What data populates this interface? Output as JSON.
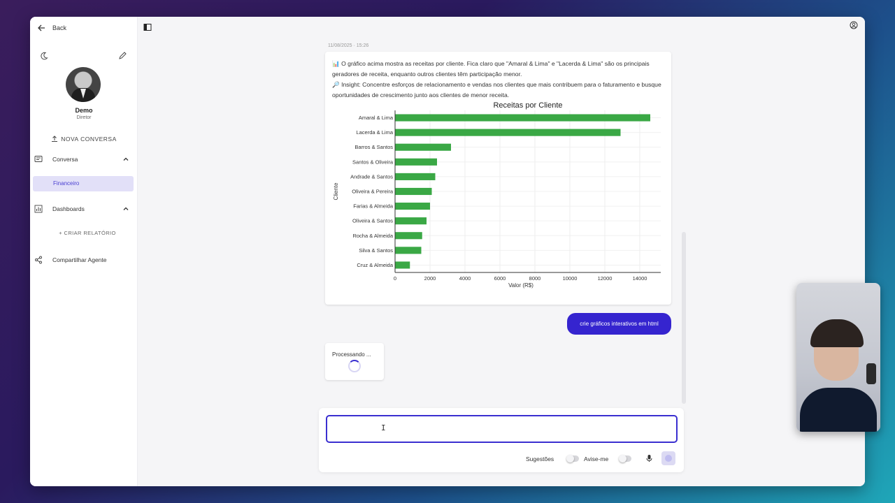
{
  "sidebar": {
    "back_label": "Back",
    "user": {
      "name": "Demo",
      "role": "Diretor"
    },
    "new_conversation_label": "NOVA CONVERSA",
    "conversation_section": {
      "label": "Conversa",
      "items": [
        {
          "label": "Financeiro",
          "active": true
        }
      ]
    },
    "dashboards_section": {
      "label": "Dashboards",
      "create_report_label": "+ CRIAR RELATÓRIO"
    },
    "share_agent_label": "Compartilhar Agente"
  },
  "chat": {
    "timestamp": "11/08/2025 · 15:26",
    "assistant_message": {
      "line1": "📊 O gráfico acima mostra as receitas por cliente. Fica claro que \"Amaral & Lima\" e \"Lacerda & Lima\" são os principais geradores de receita, enquanto outros clientes têm participação menor.",
      "line2": "🔎 Insight: Concentre esforços de relacionamento e vendas nos clientes que mais contribuem para o faturamento e busque oportunidades de crescimento junto aos clientes de menor receita."
    },
    "user_message": "crie gráficos interativos em html",
    "processing_label": "Processando ..."
  },
  "composer": {
    "input_value": "",
    "input_placeholder": "",
    "suggestions_label": "Sugestões",
    "notify_label": "Avise-me"
  },
  "colors": {
    "accent": "#3a2fd0",
    "bar": "#3aa845",
    "active_bg": "#e2e0f8"
  },
  "chart_data": {
    "type": "bar",
    "orientation": "horizontal",
    "title": "Receitas por Cliente",
    "xlabel": "Valor (R$)",
    "ylabel": "Cliente",
    "categories": [
      "Amaral & Lima",
      "Lacerda & Lima",
      "Barros & Santos",
      "Santos & Oliveira",
      "Andrade & Santos",
      "Oliveira & Pereira",
      "Farias & Almeida",
      "Oliveira & Santos",
      "Rocha & Almeida",
      "Silva & Santos",
      "Cruz & Almeida"
    ],
    "values": [
      14600,
      12900,
      3200,
      2400,
      2300,
      2100,
      2000,
      1800,
      1550,
      1500,
      850
    ],
    "xlim": [
      0,
      15200
    ],
    "xticks": [
      0,
      2000,
      4000,
      6000,
      8000,
      10000,
      12000,
      14000
    ],
    "grid": true
  }
}
